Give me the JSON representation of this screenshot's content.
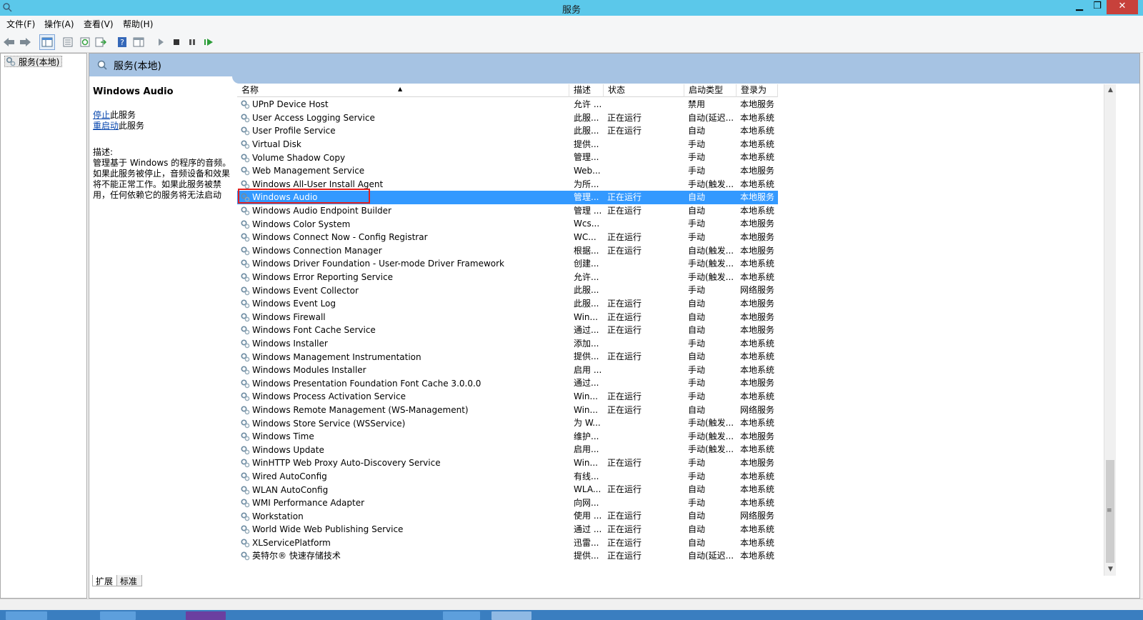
{
  "window": {
    "title": "服务"
  },
  "menu": [
    "文件(F)",
    "操作(A)",
    "查看(V)",
    "帮助(H)"
  ],
  "tree": {
    "root_label": "服务(本地)"
  },
  "panel": {
    "header_title": "服务(本地)",
    "selected_name": "Windows Audio",
    "stop_link": "停止",
    "stop_suffix": "此服务",
    "restart_link": "重启动",
    "restart_suffix": "此服务",
    "desc_label": "描述:",
    "desc_text": "管理基于 Windows 的程序的音频。如果此服务被停止，音频设备和效果将不能正常工作。如果此服务被禁用，任何依赖它的服务将无法启动"
  },
  "columns": [
    "名称",
    "描述",
    "状态",
    "启动类型",
    "登录为"
  ],
  "rows": [
    [
      "UPnP Device Host",
      "允许 ...",
      "",
      "禁用",
      "本地服务"
    ],
    [
      "User Access Logging Service",
      "此服...",
      "正在运行",
      "自动(延迟...",
      "本地系统"
    ],
    [
      "User Profile Service",
      "此服...",
      "正在运行",
      "自动",
      "本地系统"
    ],
    [
      "Virtual Disk",
      "提供...",
      "",
      "手动",
      "本地系统"
    ],
    [
      "Volume Shadow Copy",
      "管理...",
      "",
      "手动",
      "本地系统"
    ],
    [
      "Web Management Service",
      "Web...",
      "",
      "手动",
      "本地服务"
    ],
    [
      "Windows All-User Install Agent",
      "为所...",
      "",
      "手动(触发...",
      "本地系统"
    ],
    [
      "Windows Audio",
      "管理...",
      "正在运行",
      "自动",
      "本地服务"
    ],
    [
      "Windows Audio Endpoint Builder",
      "管理 ...",
      "正在运行",
      "自动",
      "本地系统"
    ],
    [
      "Windows Color System",
      "Wcs...",
      "",
      "手动",
      "本地服务"
    ],
    [
      "Windows Connect Now - Config Registrar",
      "WC...",
      "正在运行",
      "手动",
      "本地服务"
    ],
    [
      "Windows Connection Manager",
      "根据...",
      "正在运行",
      "自动(触发...",
      "本地服务"
    ],
    [
      "Windows Driver Foundation - User-mode Driver Framework",
      "创建...",
      "",
      "手动(触发...",
      "本地系统"
    ],
    [
      "Windows Error Reporting Service",
      "允许...",
      "",
      "手动(触发...",
      "本地系统"
    ],
    [
      "Windows Event Collector",
      "此服...",
      "",
      "手动",
      "网络服务"
    ],
    [
      "Windows Event Log",
      "此服...",
      "正在运行",
      "自动",
      "本地服务"
    ],
    [
      "Windows Firewall",
      "Win...",
      "正在运行",
      "自动",
      "本地服务"
    ],
    [
      "Windows Font Cache Service",
      "通过...",
      "正在运行",
      "自动",
      "本地服务"
    ],
    [
      "Windows Installer",
      "添加...",
      "",
      "手动",
      "本地系统"
    ],
    [
      "Windows Management Instrumentation",
      "提供...",
      "正在运行",
      "自动",
      "本地系统"
    ],
    [
      "Windows Modules Installer",
      "启用 ...",
      "",
      "手动",
      "本地系统"
    ],
    [
      "Windows Presentation Foundation Font Cache 3.0.0.0",
      "通过...",
      "",
      "手动",
      "本地服务"
    ],
    [
      "Windows Process Activation Service",
      "Win...",
      "正在运行",
      "手动",
      "本地系统"
    ],
    [
      "Windows Remote Management (WS-Management)",
      "Win...",
      "正在运行",
      "自动",
      "网络服务"
    ],
    [
      "Windows Store Service (WSService)",
      "为 W...",
      "",
      "手动(触发...",
      "本地系统"
    ],
    [
      "Windows Time",
      "维护...",
      "",
      "手动(触发...",
      "本地服务"
    ],
    [
      "Windows Update",
      "启用...",
      "",
      "手动(触发...",
      "本地系统"
    ],
    [
      "WinHTTP Web Proxy Auto-Discovery Service",
      "Win...",
      "正在运行",
      "手动",
      "本地服务"
    ],
    [
      "Wired AutoConfig",
      "有线...",
      "",
      "手动",
      "本地系统"
    ],
    [
      "WLAN AutoConfig",
      "WLA...",
      "正在运行",
      "自动",
      "本地系统"
    ],
    [
      "WMI Performance Adapter",
      "向网...",
      "",
      "手动",
      "本地系统"
    ],
    [
      "Workstation",
      "使用 ...",
      "正在运行",
      "自动",
      "网络服务"
    ],
    [
      "World Wide Web Publishing Service",
      "通过 ...",
      "正在运行",
      "自动",
      "本地系统"
    ],
    [
      "XLServicePlatform",
      "迅雷...",
      "正在运行",
      "自动",
      "本地系统"
    ],
    [
      "英特尔® 快速存储技术",
      "提供...",
      "正在运行",
      "自动(延迟...",
      "本地系统"
    ]
  ],
  "selected_row": 7,
  "tabs": [
    "扩展",
    "标准"
  ],
  "colors": {
    "titlebar": "#5bc8ea",
    "selection": "#3399ff",
    "header": "#a6c3e3",
    "highlight_box": "#e02020"
  }
}
